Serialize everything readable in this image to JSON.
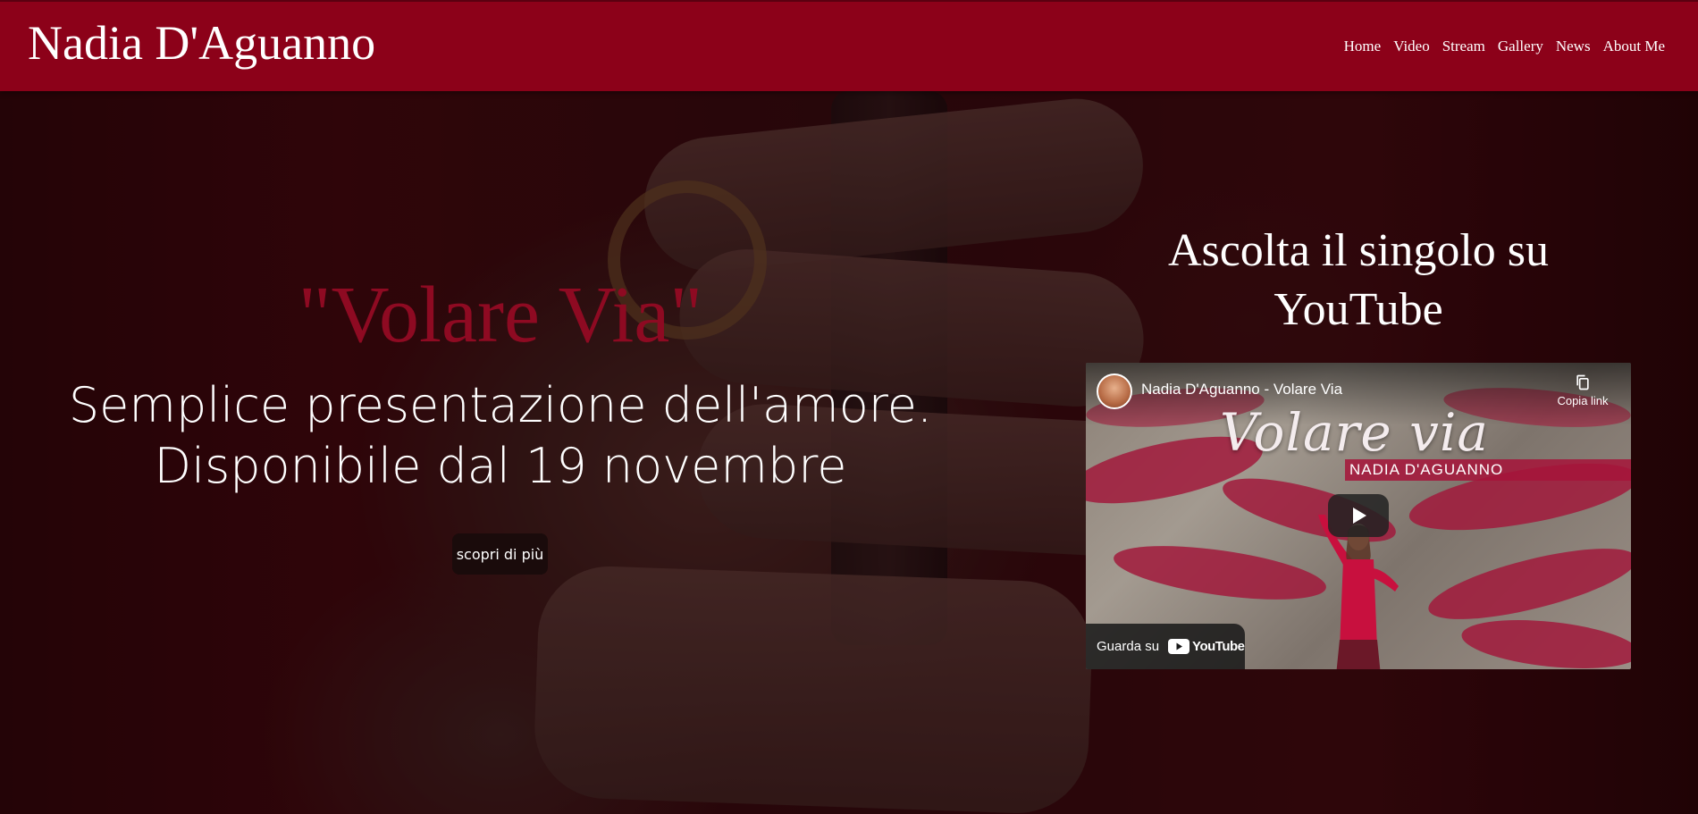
{
  "header": {
    "brand": "Nadia D'Aguanno",
    "nav": [
      "Home",
      "Video",
      "Stream",
      "Gallery",
      "News",
      "About Me"
    ]
  },
  "hero": {
    "song_title": "\"Volare Via\"",
    "tagline_line1": "Semplice presentazione dell'amore.",
    "tagline_line2": "Disponibile dal 19 novembre",
    "more_button": "scopri di più",
    "listen_line1": "Ascolta il singolo su",
    "listen_line2": "YouTube"
  },
  "video": {
    "title": "Nadia D'Aguanno - Volare Via",
    "copy_link": "Copia link",
    "overlay_title": "Volare via",
    "overlay_artist": "NADIA D'AGUANNO",
    "watch_on": "Guarda su",
    "youtube_word": "YouTube"
  },
  "colors": {
    "header_bg": "#8c0119",
    "song_title": "#8e0a22",
    "youtube_red": "#ff0000"
  }
}
